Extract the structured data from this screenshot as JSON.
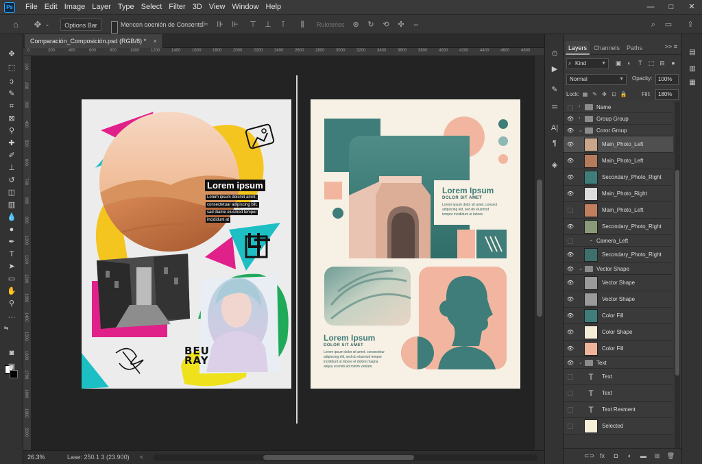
{
  "menu": [
    "File",
    "Edit",
    "Image",
    "Layer",
    "Type",
    "Select",
    "Filter",
    "3D",
    "View",
    "Window",
    "Help"
  ],
  "app_logo": "Ps",
  "window_controls": {
    "minimize": "—",
    "maximize": "□",
    "close": "✕"
  },
  "options_bar": {
    "options_button": "Options Bar",
    "checkbox_label": "Mencen ɑoenión de Consents",
    "ruloteries": "Ruloteries"
  },
  "document_tab": {
    "title": "Comparación_Composición.psd (RGB/8) *",
    "close": "×"
  },
  "hruler_ticks": [
    "0",
    "200",
    "400",
    "600",
    "800",
    "1000",
    "1200",
    "1400",
    "1600",
    "1800",
    "2000",
    "2200",
    "2400",
    "2600",
    "2800",
    "3000",
    "3200",
    "3400",
    "3600",
    "3800",
    "4000",
    "4200",
    "4400",
    "4600",
    "4800"
  ],
  "vruler_ticks": [
    "100",
    "200",
    "300",
    "400",
    "500",
    "600",
    "700",
    "800",
    "900",
    "1000",
    "1100",
    "1200",
    "1300",
    "1400",
    "1500",
    "1600",
    "1700",
    "1800",
    "1900",
    "2000"
  ],
  "status": {
    "zoom": "26.3%",
    "doc_size": "Lase: 250.1 3 (23.900)",
    "arrow": "<"
  },
  "left_artboard": {
    "heading": "Lorem ipsum",
    "body_lines": [
      "Lorem ipsum dolsmit amnt,",
      "consectetuar adipiscing bilt,",
      "sad diame elusmod temper",
      "incididunt at"
    ],
    "logo_text": "BEU RAY"
  },
  "right_artboard": {
    "heading1": "Lorem Ipsum",
    "sub1": "DOLOR SIT AMET",
    "body1": [
      "Lorem ipsum dolor sit amet, consect",
      "adipiscing elit, sed do eiusmod",
      "tempor incididunt ut labore."
    ],
    "heading2": "Lorem Ipsum",
    "sub2": "DOLOR SIT AMET",
    "body2": [
      "Lorem ipsum dolor sit amet, consectetur",
      "adipiscing elit, sed do eiusmod tempor",
      "incididunt ut labore et dolore magna",
      "aliqua ut enim ad minim veniam."
    ]
  },
  "layers_panel": {
    "tabs": [
      "Layers",
      "Channels",
      "Paths"
    ],
    "menu": ">> ≡",
    "kind": "Kind",
    "blend": "Normal",
    "opacity_label": "Opacity:",
    "opacity": "100%",
    "lock_label": "Lock:",
    "fill_label": "Fill:",
    "fill": "180%",
    "layers": [
      {
        "name": "Name",
        "kind": "group",
        "visible": false,
        "indent": 0
      },
      {
        "name": "Group Group",
        "kind": "group",
        "visible": true,
        "indent": 0
      },
      {
        "name": "Coror Group",
        "kind": "group",
        "visible": true,
        "indent": 0,
        "open": true
      },
      {
        "name": "Main_Photo_Left",
        "kind": "image",
        "visible": true,
        "indent": 1,
        "selected": true,
        "thumb": "#c9a58a"
      },
      {
        "name": "Main_Photo_Left",
        "kind": "image",
        "visible": true,
        "indent": 1,
        "thumb": "#b47c5a"
      },
      {
        "name": "Secondary_Photo_Right",
        "kind": "image",
        "visible": true,
        "indent": 1,
        "thumb": "#3e7d79"
      },
      {
        "name": "Main_Photo_Right",
        "kind": "image",
        "visible": true,
        "indent": 1,
        "thumb": "#dcdcdc"
      },
      {
        "name": "Main_Photo_Left",
        "kind": "image",
        "visible": false,
        "indent": 1,
        "thumb": "#c08060"
      },
      {
        "name": "Secondary_Photo_Right",
        "kind": "image",
        "visible": true,
        "indent": 1,
        "thumb": "#8a9a78"
      },
      {
        "name": "Camera_Left",
        "kind": "sub",
        "visible": false,
        "indent": 2
      },
      {
        "name": "Secondary_Photo_Right",
        "kind": "image",
        "visible": true,
        "indent": 1,
        "thumb": "#3f6f6c"
      },
      {
        "name": "Vector Shape",
        "kind": "group",
        "visible": true,
        "indent": 0,
        "open": true
      },
      {
        "name": "Vector Shape",
        "kind": "shape",
        "visible": true,
        "indent": 1,
        "thumb": "#9a9a9a"
      },
      {
        "name": "Vector Shape",
        "kind": "shape",
        "visible": true,
        "indent": 1,
        "thumb": "#9a9a9a"
      },
      {
        "name": "Color Fill",
        "kind": "shape",
        "visible": true,
        "indent": 1,
        "thumb": "#3e7d79"
      },
      {
        "name": "Color Shape",
        "kind": "shape",
        "visible": true,
        "indent": 1,
        "thumb": "#f3ecd6"
      },
      {
        "name": "Color Fill",
        "kind": "shape",
        "visible": true,
        "indent": 1,
        "thumb": "#f0b49a"
      },
      {
        "name": "Text",
        "kind": "group",
        "visible": true,
        "indent": 0,
        "open": true
      },
      {
        "name": "Text",
        "kind": "text",
        "visible": false,
        "indent": 1
      },
      {
        "name": "Text",
        "kind": "text",
        "visible": false,
        "indent": 1
      },
      {
        "name": "Text Resment",
        "kind": "text",
        "visible": false,
        "indent": 1
      },
      {
        "name": "Selected",
        "kind": "shape",
        "visible": false,
        "indent": 1,
        "thumb": "#f6efd9"
      }
    ]
  },
  "colors": {
    "teal": "#3e7d79",
    "peach": "#f2b6a0",
    "magenta": "#e0218a",
    "yellow": "#f4c51e",
    "cyan": "#1cbfc4",
    "green": "#1faa5a",
    "cream": "#f7f0e4"
  }
}
